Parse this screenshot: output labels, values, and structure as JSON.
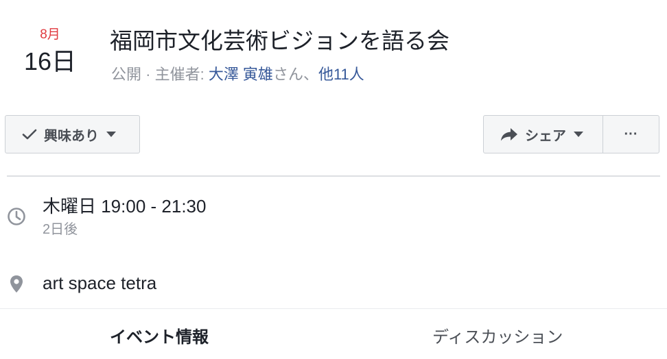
{
  "event": {
    "month": "8月",
    "day": "16日",
    "title": "福岡市文化芸術ビジョンを語る会",
    "privacy": "公開",
    "separator": " · ",
    "host_prefix": "主催者: ",
    "host_name": "大澤 寅雄",
    "host_suffix": "さん、",
    "others": "他11人"
  },
  "actions": {
    "interested_label": "興味あり",
    "share_label": "シェア",
    "more_label": "···"
  },
  "details": {
    "time_main": "木曜日 19:00 - 21:30",
    "time_sub": "2日後",
    "place": "art space tetra"
  },
  "tabs": [
    {
      "label": "イベント情報",
      "active": true
    },
    {
      "label": "ディスカッション",
      "active": false
    }
  ],
  "icons": {
    "check": "check-icon",
    "caret": "caret-down-icon",
    "share": "share-arrow-icon",
    "clock": "clock-icon",
    "pin": "map-pin-icon"
  },
  "colors": {
    "date_month": "#e0393e",
    "link": "#365899",
    "muted": "#90949c",
    "text": "#1d2129",
    "button_bg": "#f5f6f7",
    "button_border": "#ccd0d5"
  }
}
